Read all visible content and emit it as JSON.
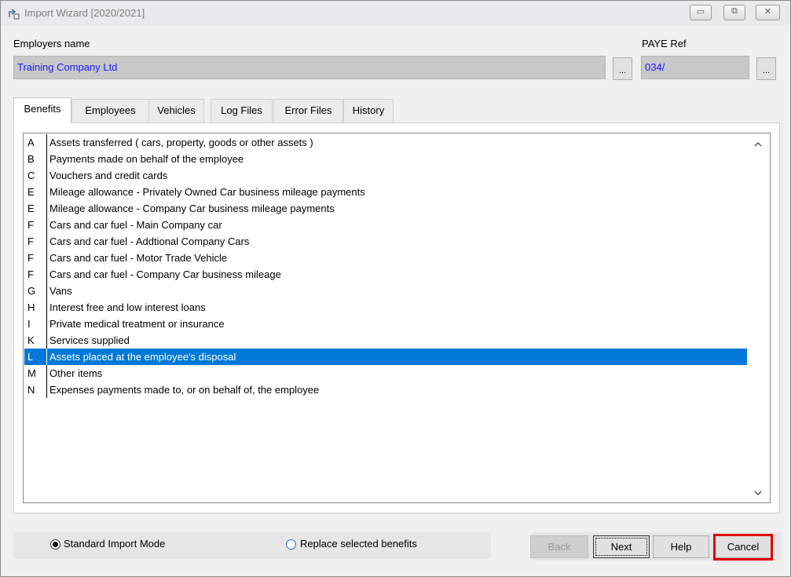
{
  "window": {
    "title": "Import Wizard [2020/2021]",
    "minimize_icon": "minimize-icon",
    "maximize_icon": "maximize-icon",
    "close_icon": "close-icon"
  },
  "employer": {
    "label": "Employers name",
    "value": "Training Company Ltd",
    "browse_label": "..."
  },
  "paye": {
    "label": "PAYE Ref",
    "value": "034/",
    "browse_label": "..."
  },
  "tabs": [
    {
      "label": "Benefits",
      "active": true
    },
    {
      "label": "Employees",
      "active": false
    },
    {
      "label": "Vehicles",
      "active": false
    },
    {
      "label": "Log Files",
      "active": false
    },
    {
      "label": "Error Files",
      "active": false
    },
    {
      "label": "History",
      "active": false
    }
  ],
  "benefits": [
    {
      "code": "A",
      "desc": "Assets transferred ( cars, property, goods or other assets )"
    },
    {
      "code": "B",
      "desc": "Payments made on behalf of the employee"
    },
    {
      "code": "C",
      "desc": "Vouchers and credit cards"
    },
    {
      "code": "E",
      "desc": "Mileage allowance - Privately Owned Car business mileage payments"
    },
    {
      "code": "E",
      "desc": "Mileage allowance - Company Car business mileage payments"
    },
    {
      "code": "F",
      "desc": "Cars and car fuel - Main Company car"
    },
    {
      "code": "F",
      "desc": "Cars and car fuel - Addtional Company Cars"
    },
    {
      "code": "F",
      "desc": "Cars and car fuel - Motor Trade Vehicle"
    },
    {
      "code": "F",
      "desc": "Cars and car fuel - Company Car business mileage"
    },
    {
      "code": "G",
      "desc": "Vans"
    },
    {
      "code": "H",
      "desc": "Interest free and low interest loans"
    },
    {
      "code": "I",
      "desc": "Private medical treatment or insurance"
    },
    {
      "code": "K",
      "desc": "Services supplied"
    },
    {
      "code": "L",
      "desc": "Assets placed at the employee's disposal",
      "selected": true
    },
    {
      "code": "M",
      "desc": "Other items"
    },
    {
      "code": "N",
      "desc": "Expenses payments made to, or on behalf of, the employee"
    }
  ],
  "scroll": {
    "up_icon": "chevron-up-icon",
    "down_icon": "chevron-down-icon"
  },
  "import_mode": {
    "standard_label": "Standard Import Mode",
    "replace_label": "Replace selected benefits",
    "selected": "standard"
  },
  "buttons": {
    "back": "Back",
    "next": "Next",
    "help": "Help",
    "cancel": "Cancel"
  },
  "colors": {
    "selection": "#0078d7",
    "field_text": "#1a1aff",
    "highlight": "#e00000"
  }
}
